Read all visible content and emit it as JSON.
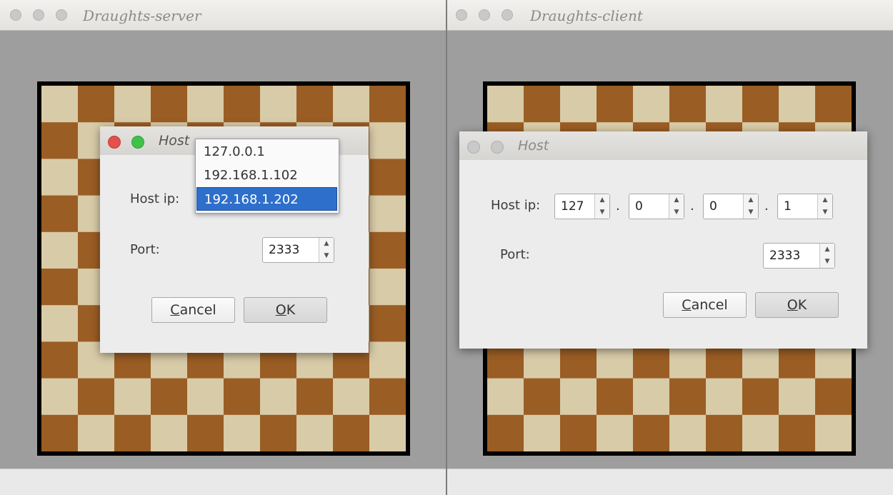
{
  "server_window": {
    "title": "Draughts-server"
  },
  "client_window": {
    "title": "Draughts-client"
  },
  "colors": {
    "light_square": "#d8cba8",
    "dark_square": "#9a5d24",
    "selection": "#2e6fcb"
  },
  "server_dialog": {
    "title": "Host",
    "host_ip_label": "Host ip:",
    "port_label": "Port:",
    "port_value": "2333",
    "cancel": {
      "accel": "C",
      "rest": "ancel"
    },
    "ok": {
      "accel": "O",
      "rest": "K"
    },
    "host_options": [
      "127.0.0.1",
      "192.168.1.102",
      "192.168.1.202"
    ],
    "selected_option": "192.168.1.202"
  },
  "client_dialog": {
    "title": "Host",
    "host_ip_label": "Host ip:",
    "octets": [
      "127",
      "0",
      "0",
      "1"
    ],
    "dot": ".",
    "port_label": "Port:",
    "port_value": "2333",
    "cancel": {
      "accel": "C",
      "rest": "ancel"
    },
    "ok": {
      "accel": "O",
      "rest": "K"
    }
  }
}
